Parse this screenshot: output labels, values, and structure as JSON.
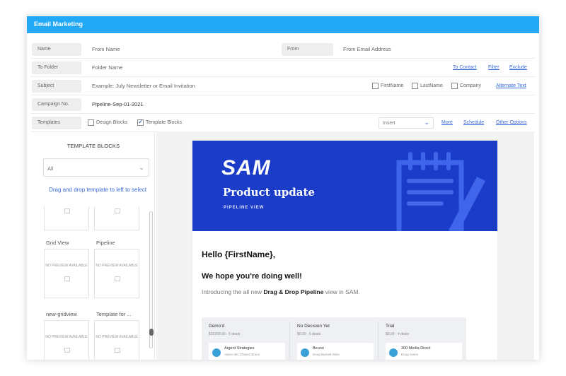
{
  "title": "Email Marketing",
  "form": {
    "name": {
      "label": "Name",
      "placeholder": "From Name"
    },
    "from": {
      "label": "From",
      "placeholder": "From Email Address"
    },
    "to_folder": {
      "label": "To Folder",
      "placeholder": "Folder Name",
      "links": [
        "To Contact",
        "Filter",
        "Exclude"
      ]
    },
    "subject": {
      "label": "Subject",
      "placeholder": "Example: July Newsletter or Email Invitation",
      "checkboxes": [
        "FirstName",
        "LastName",
        "Company"
      ],
      "link": "Alternate Text"
    },
    "campaign": {
      "label": "Campaign No.",
      "value": "Pipeline-Sep-01-2021"
    },
    "templates": {
      "label": "Templates",
      "opt_design": "Design Blocks",
      "opt_template": "Template Blocks",
      "select_value": "Insert",
      "links": [
        "More",
        "Schedule",
        "Other Options"
      ]
    }
  },
  "left": {
    "title": "TEMPLATE BLOCKS",
    "filter_value": "All",
    "hint": "Drag and drop template to left to select",
    "no_preview": "NO PREVIEW AVAILABLE",
    "items": [
      "Grid View",
      "Pipeline",
      "new-gridview",
      "Template for ..."
    ]
  },
  "email": {
    "logo": "SAM",
    "product": "Product update",
    "pipeline_view": "PIPELINE VIEW",
    "hello": "Hello {FirstName},",
    "hope": "We hope you're doing well!",
    "intro_pre": "Introducing the all new ",
    "intro_bold": "Drag & Drop Pipeline",
    "intro_post": " view in SAM.",
    "pipeline": [
      {
        "header": "Demo'd",
        "sub": "$10200.00 - 5 deals",
        "card": "Argent Strategies",
        "person": "Aaron dev Chavez Bruno"
      },
      {
        "header": "No Decision Yet",
        "sub": "$0.00 - 5 deals",
        "card": "Beuno",
        "person": "Doug Burnett Wise"
      },
      {
        "header": "Trial",
        "sub": "$0.00 - 4 deals",
        "card": "300 Media Direct",
        "person": "Doug Jones"
      }
    ]
  },
  "colors": {
    "accent": "#21a8f7",
    "banner": "#1b3bc9",
    "link": "#3b6ad8"
  }
}
